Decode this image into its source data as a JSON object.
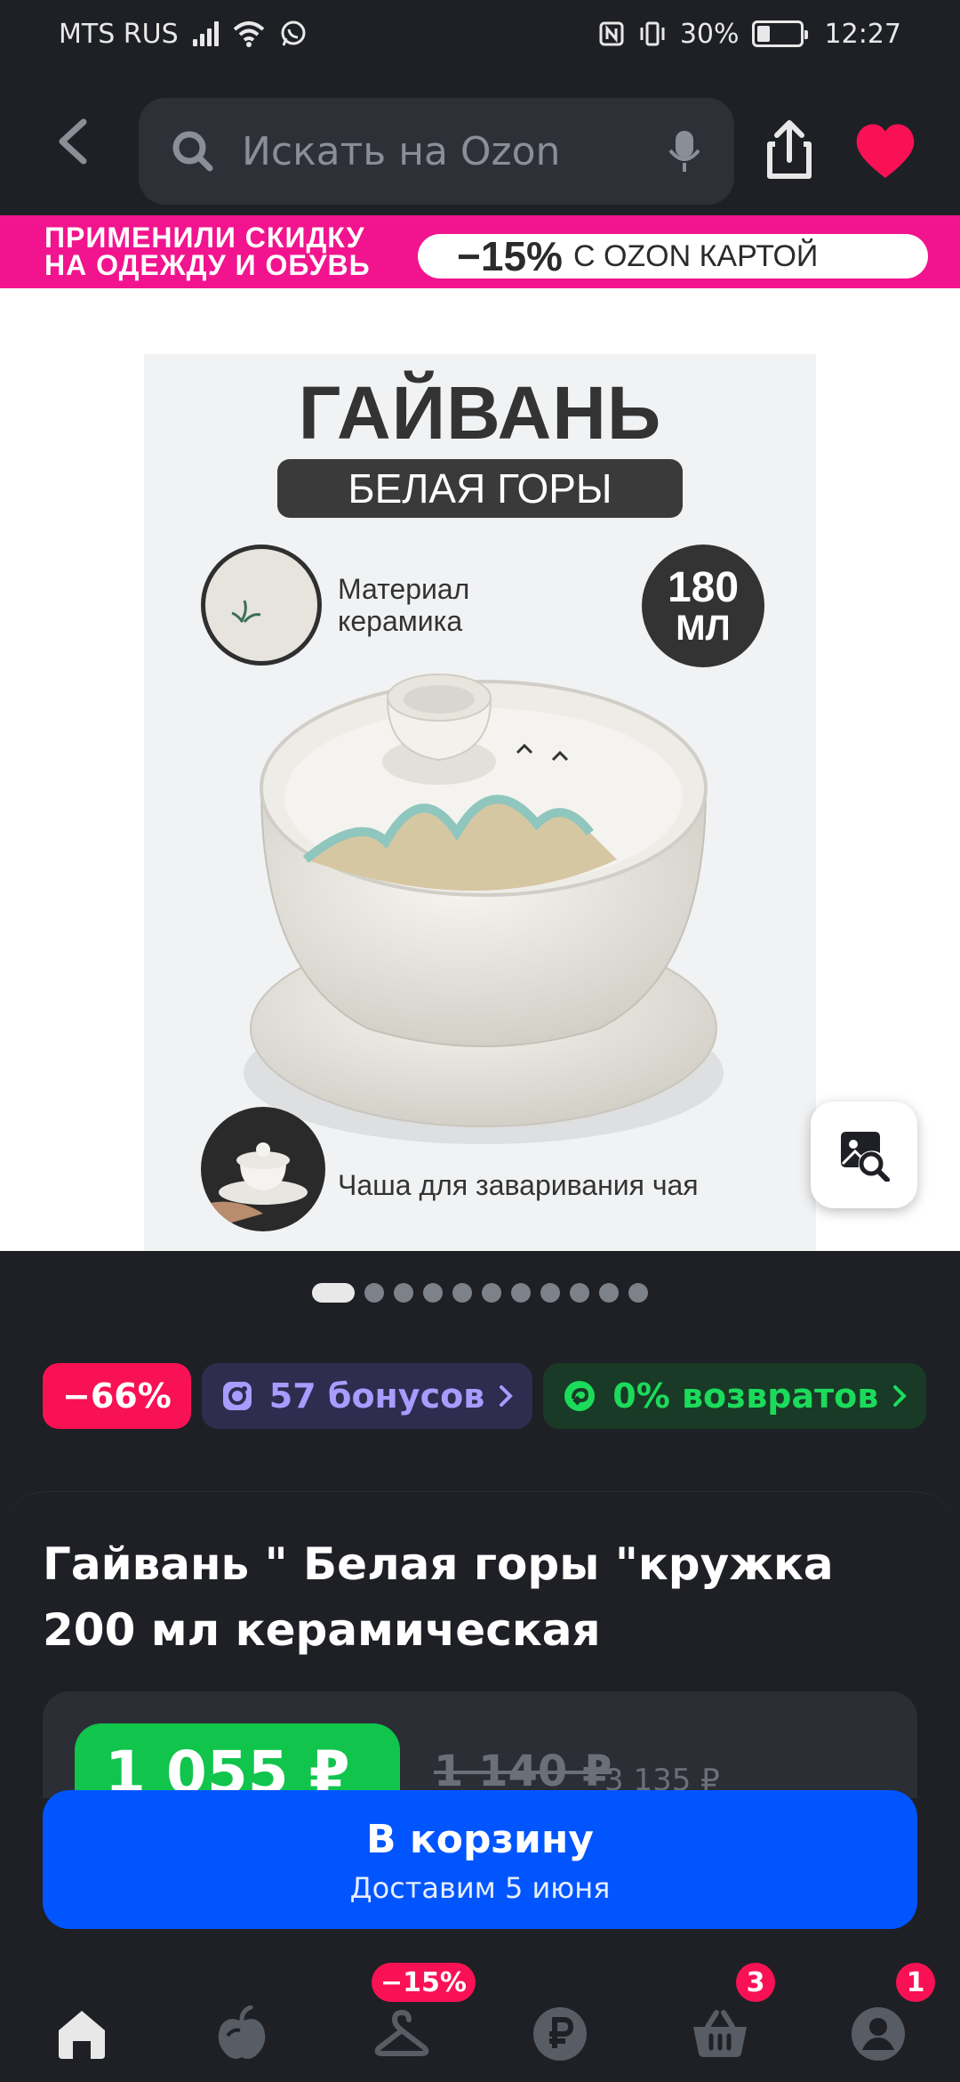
{
  "status_bar": {
    "carrier": "MTS RUS",
    "battery": "30%",
    "battery_level": 0.3,
    "time": "12:27"
  },
  "header": {
    "search_placeholder": "Искать на Ozon"
  },
  "promo": {
    "line1": "ПРИМЕНИЛИ СКИДКУ",
    "line2": "НА ОДЕЖДУ И ОБУВЬ",
    "discount": "−15%",
    "discount_rest": "С OZON КАРТОЙ"
  },
  "product_image": {
    "title": "ГАЙВАНЬ",
    "subtitle": "БЕЛАЯ ГОРЫ",
    "material_line1": "Материал",
    "material_line2": "керамика",
    "volume_number": "180",
    "volume_unit": "МЛ",
    "usage": "Чаша для заваривания чая"
  },
  "gallery": {
    "slide_count": 11,
    "active_slide": 1
  },
  "badges": {
    "sale": "−66%",
    "bonus": "57 бонусов",
    "returns": "0% возвратов"
  },
  "product": {
    "title": "Гайвань \" Белая горы \"кружка 200 мл керамическая",
    "price_current": "1 055 ₽",
    "price_old": "1 140 ₽",
    "price_alt": "3 135 ₽"
  },
  "cart_button": {
    "label": "В корзину",
    "delivery": "Доставим 5 июня"
  },
  "bottom_nav": {
    "fresh_badge": "−15%",
    "cart_count": "3",
    "profile_count": "1"
  },
  "colors": {
    "promo_pink": "#f2148e",
    "sale_red": "#f91155",
    "price_green": "#10c44c",
    "cart_blue": "#0055ff",
    "favorite_red": "#f91155"
  }
}
